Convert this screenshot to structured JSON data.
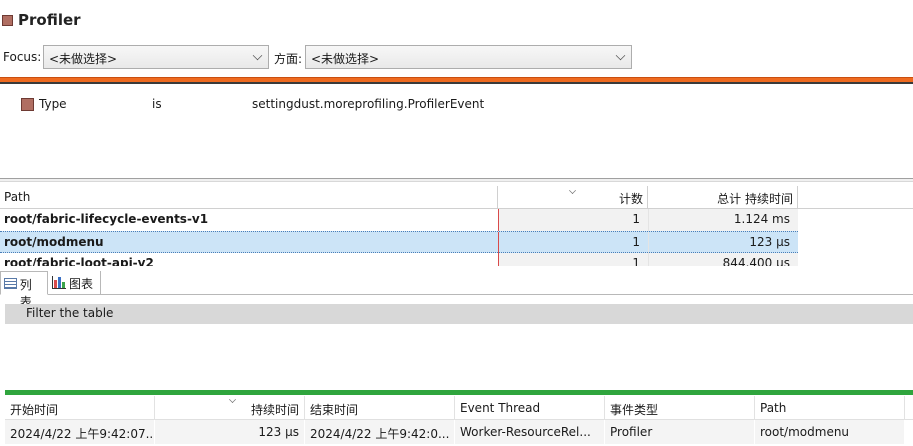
{
  "header": {
    "title": "Profiler"
  },
  "focus": {
    "focus_label": "Focus:",
    "focus_value": "<未做选择>",
    "aspect_label": "方面:",
    "aspect_value": "<未做选择>"
  },
  "filter_condition": {
    "field": "Type",
    "operator": "is",
    "value": "settingdust.moreprofiling.ProfilerEvent"
  },
  "aggregation_table": {
    "columns": [
      "Path",
      "计数",
      "总计 持续时间"
    ],
    "rows": [
      {
        "path": "root/fabric-lifecycle-events-v1",
        "count": "1",
        "total": "1.124 ms"
      },
      {
        "path": "root/modmenu",
        "count": "1",
        "total": "123 μs",
        "selected": true
      },
      {
        "path": "root/fabric-loot-api-v2",
        "count": "1",
        "total": "844.400 μs"
      }
    ]
  },
  "tabs": [
    {
      "label": "列表",
      "icon": "list-icon",
      "active": true
    },
    {
      "label": "图表",
      "icon": "bar-chart-icon",
      "active": false
    }
  ],
  "table_filter": {
    "placeholder": "Filter the table"
  },
  "event_table": {
    "columns": [
      "开始时间",
      "持续时间",
      "结束时间",
      "Event Thread",
      "事件类型",
      "Path"
    ],
    "rows": [
      {
        "start": "2024/4/22 上午9:42:07....",
        "duration": "123 μs",
        "end": "2024/4/22 上午9:42:0...",
        "thread": "Worker-ResourceRel...",
        "type": "Profiler",
        "path": "root/modmenu"
      }
    ]
  },
  "colors": {
    "accent_orange": "#ee6a1f",
    "accent_green": "#2fa53d",
    "selection": "#cce4f7",
    "event_type_swatch": "#b06e62"
  }
}
